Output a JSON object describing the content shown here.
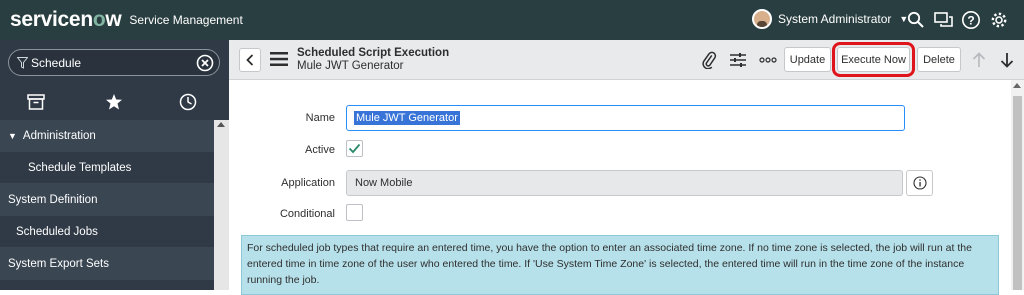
{
  "header": {
    "logo_service": "service",
    "logo_now": "now",
    "product": "Service Management",
    "user_name": "System Administrator",
    "icons": [
      "search-icon",
      "chat-icon",
      "help-icon",
      "gear-icon"
    ]
  },
  "sidebar": {
    "filter_value": "Schedule",
    "tabs": [
      "archive-icon",
      "star-icon",
      "history-icon"
    ],
    "items": [
      {
        "label": "Administration",
        "kind": "level0",
        "expanded": true
      },
      {
        "label": "Schedule Templates",
        "kind": "level1"
      },
      {
        "label": "System Definition",
        "kind": "app"
      },
      {
        "label": "Scheduled Jobs",
        "kind": "module"
      },
      {
        "label": "System Export Sets",
        "kind": "app"
      }
    ]
  },
  "form_header": {
    "table_label": "Scheduled Script Execution",
    "record_name": "Mule JWT Generator",
    "buttons": {
      "update": "Update",
      "execute_now": "Execute Now",
      "delete": "Delete"
    }
  },
  "form": {
    "name_label": "Name",
    "name_value": "Mule JWT Generator",
    "active_label": "Active",
    "active_checked": true,
    "application_label": "Application",
    "application_value": "Now Mobile",
    "conditional_label": "Conditional",
    "conditional_checked": false,
    "info_text": "For scheduled job types that require an entered time, you have the option to enter an associated time zone. If no time zone is selected, the job will run at the entered time in time zone of the user who entered the time. If 'Use System Time Zone' is selected, the entered time will run in the time zone of the instance running the job."
  },
  "colors": {
    "header_bg": "#293e40",
    "logo_accent": "#81b5a1",
    "sidebar_bg": "#303a46",
    "focus_blue": "#278efc",
    "highlight_red": "#e0151c",
    "note_bg": "#b7e1ea",
    "check_green": "#2b8a6b"
  }
}
